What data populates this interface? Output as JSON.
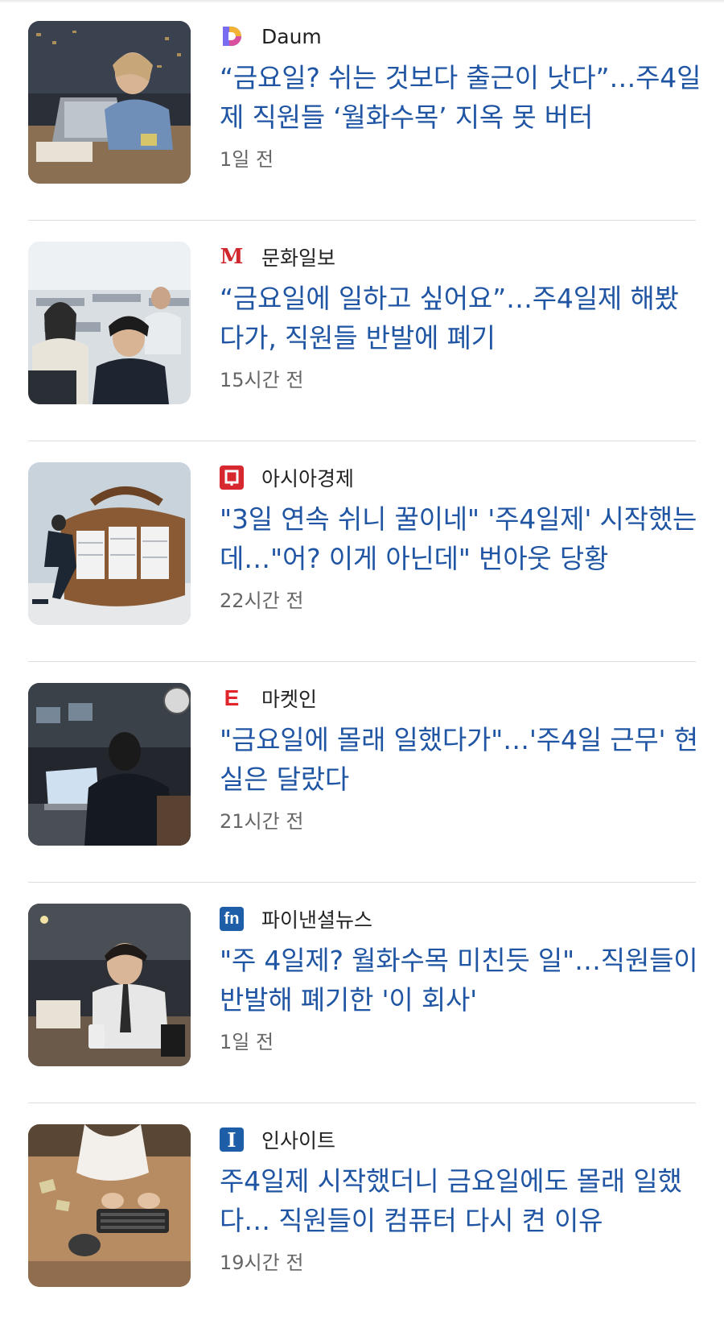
{
  "items": [
    {
      "source": "Daum",
      "logo_icon": "daum-logo-icon",
      "headline": "“금요일? 쉬는 것보다 출근이 낫다”…주4일제 직원들 ‘월화수목’ 지옥 못 버터",
      "time": "1일 전"
    },
    {
      "source": "문화일보",
      "logo_icon": "munhwa-logo-icon",
      "logo_text": "M",
      "headline": "“금요일에 일하고 싶어요”…주4일제 해봤다가, 직원들 반발에 폐기",
      "time": "15시간 전"
    },
    {
      "source": "아시아경제",
      "logo_icon": "asiae-logo-icon",
      "headline": "\"3일 연속 쉬니 꿀이네\" '주4일제' 시작했는데…\"어? 이게 아닌데\" 번아웃 당황",
      "time": "22시간 전"
    },
    {
      "source": "마켓인",
      "logo_icon": "marketin-logo-icon",
      "logo_text": "E",
      "headline": "\"금요일에 몰래 일했다가\"…'주4일 근무' 현실은 달랐다",
      "time": "21시간 전"
    },
    {
      "source": "파이낸셜뉴스",
      "logo_icon": "fnnews-logo-icon",
      "logo_text": "fn",
      "headline": "\"주 4일제? 월화수목 미친듯 일\"…직원들이 반발해 폐기한 '이 회사'",
      "time": "1일 전"
    },
    {
      "source": "인사이트",
      "logo_icon": "insight-logo-icon",
      "logo_text": "I",
      "headline": "주4일제 시작했더니 금요일에도 몰래 일했다… 직원들이 컴퓨터 다시 켠 이유",
      "time": "19시간 전"
    }
  ]
}
